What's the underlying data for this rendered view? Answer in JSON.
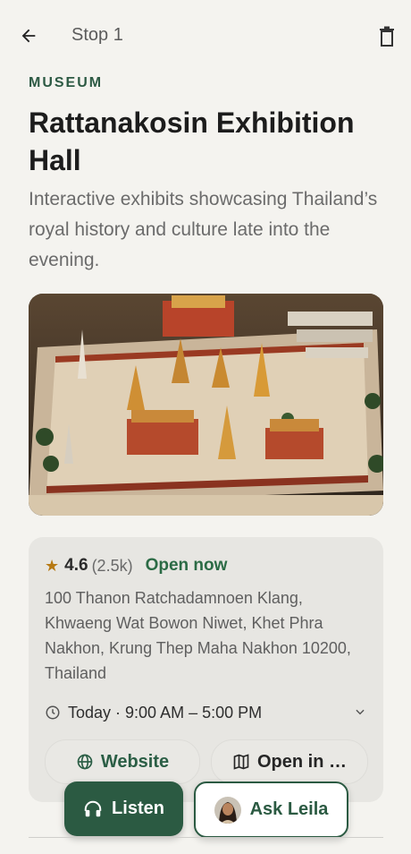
{
  "header": {
    "title": "Stop 1",
    "back_icon": "arrow-left-icon",
    "delete_icon": "trash-icon"
  },
  "place": {
    "category": "MUSEUM",
    "title": "Rattanakosin Exhibition Hall",
    "description": "Interactive exhibits showcasing Thailand’s royal history and culture late into the evening."
  },
  "details": {
    "rating": "4.6",
    "review_count": "(2.5k)",
    "status": "Open now",
    "address": "100 Thanon Ratchadamnoen Klang, Khwaeng Wat Bowon Niwet, Khet Phra Nakhon, Krung Thep Maha Nakhon 10200, Thailand",
    "hours": "Today · 9:00 AM – 5:00 PM",
    "website_label": "Website",
    "maps_label": "Open in …"
  },
  "actions": {
    "listen_label": "Listen",
    "ask_label": "Ask Leila"
  },
  "colors": {
    "accent": "#2b5a42",
    "star": "#b77a14",
    "background": "#f4f3ef",
    "card": "#e7e6e2"
  }
}
